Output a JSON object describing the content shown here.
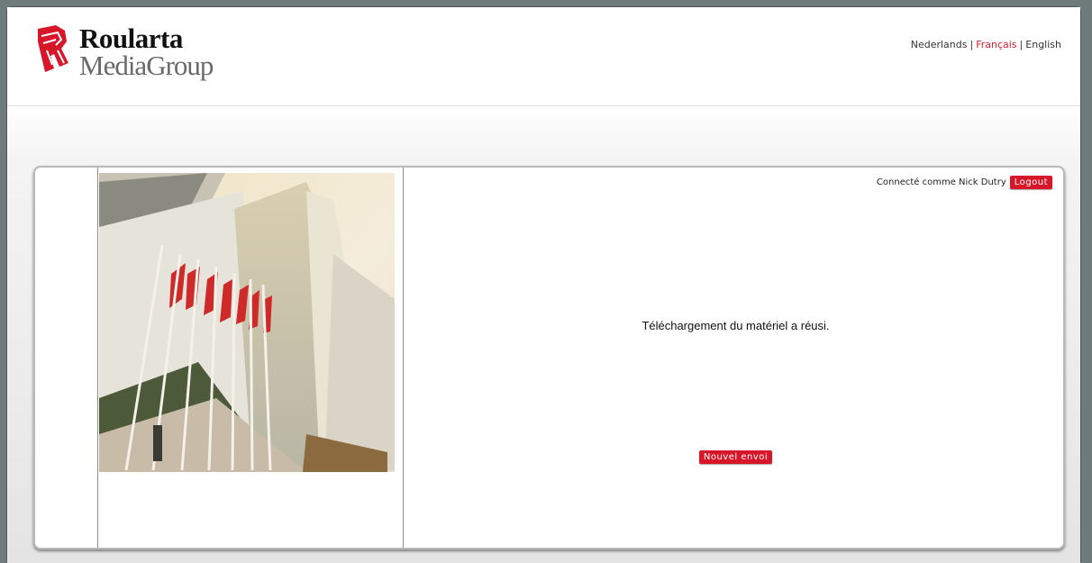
{
  "header": {
    "logo_line1": "Roularta",
    "logo_line2": "MediaGroup",
    "languages": [
      {
        "label": "Nederlands",
        "active": false
      },
      {
        "label": "Français",
        "active": true
      },
      {
        "label": "English",
        "active": false
      }
    ],
    "separator": "|"
  },
  "content": {
    "logged_in_label": "Connecté comme Nick Dutry",
    "logout_label": "Logout",
    "message": "Téléchargement du matériel a réusi.",
    "new_upload_label": "Nouvel envoi"
  },
  "colors": {
    "accent_red": "#d8162a",
    "active_lang": "#d21f2b",
    "outer_bg": "#6f7a7a"
  },
  "icons": {
    "logo_mark": "roularta-r-logo-icon"
  }
}
